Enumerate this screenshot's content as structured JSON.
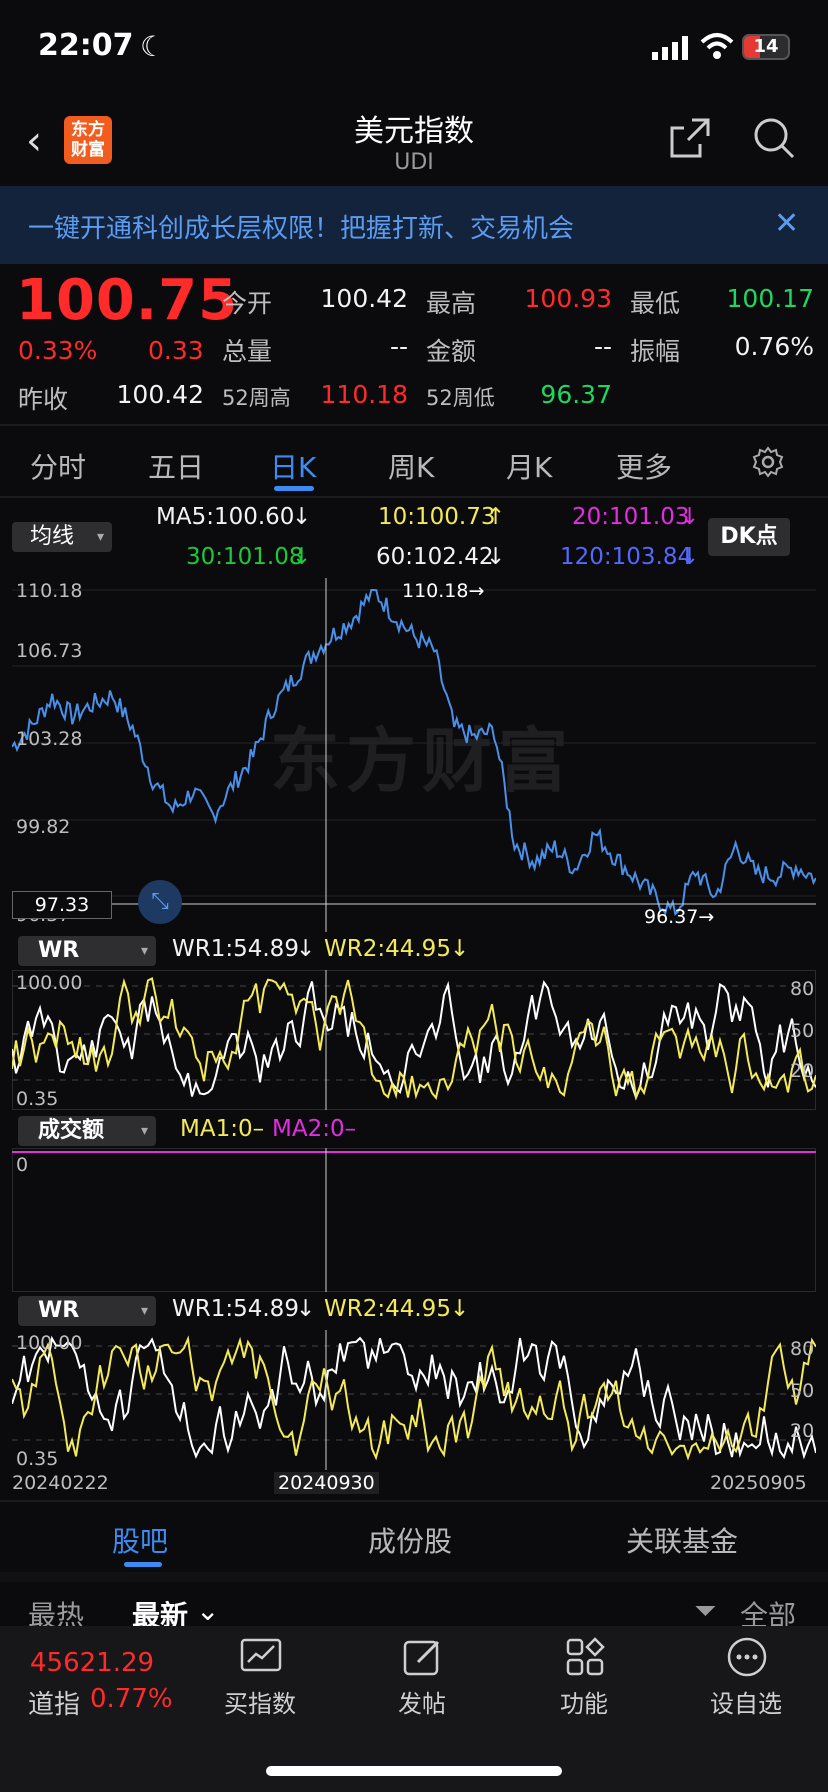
{
  "status_bar": {
    "time": "22:07",
    "battery": "14"
  },
  "header": {
    "logo_text_1": "东方",
    "logo_text_2": "财富",
    "title": "美元指数",
    "subtitle": "UDI"
  },
  "banner": {
    "text": "一键开通科创成长层权限！把握打新、交易机会"
  },
  "quote": {
    "price": "100.75",
    "change_pct": "0.33%",
    "change": "0.33",
    "prev_close_label": "昨收",
    "prev_close": "100.42",
    "open_label": "今开",
    "open": "100.42",
    "high_label": "最高",
    "high": "100.93",
    "low_label": "最低",
    "low": "100.17",
    "volume_label": "总量",
    "volume": "--",
    "amount_label": "金额",
    "amount": "--",
    "amplitude_label": "振幅",
    "amplitude": "0.76%",
    "w52_high_label": "52周高",
    "w52_high": "110.18",
    "w52_low_label": "52周低",
    "w52_low": "96.37"
  },
  "chart_tabs": [
    "分时",
    "五日",
    "日K",
    "周K",
    "月K",
    "更多"
  ],
  "ma": {
    "selector": "均线",
    "ma5": "MA5:100.60",
    "ma10": "10:100.73",
    "ma20": "20:101.03",
    "ma30": "30:101.08",
    "ma60": "60:102.42",
    "ma120": "120:103.84",
    "dk": "DK点"
  },
  "kline": {
    "y_labels": [
      "110.18",
      "106.73",
      "103.28",
      "99.82",
      "96.37"
    ],
    "max_label": "110.18",
    "min_label": "96.37",
    "cursor_price": "97.33",
    "watermark": "东方财富"
  },
  "wr1": {
    "selector": "WR",
    "wr1": "WR1:54.89",
    "wr2": "WR2:44.95",
    "top": "100.00",
    "bottom": "0.35",
    "r80": "80",
    "r50": "50",
    "r20": "20"
  },
  "amount_panel": {
    "selector": "成交额",
    "ma1": "MA1:0–",
    "ma2": "MA2:0–",
    "zero": "0"
  },
  "wr2": {
    "selector": "WR",
    "wr1": "WR1:54.89",
    "wr2": "WR2:44.95",
    "top": "100.00",
    "bottom": "0.35",
    "r80": "80",
    "r50": "50",
    "r20": "20"
  },
  "dates": {
    "start": "20240222",
    "cursor": "20240930",
    "end": "20250905"
  },
  "bottom_tabs": [
    "股吧",
    "成份股",
    "关联基金"
  ],
  "sub_tabs": {
    "hot": "最热",
    "newest": "最新",
    "filter": "全部"
  },
  "footer": {
    "dow_value": "45621.29",
    "dow_label": "道指",
    "dow_pct": "0.77%",
    "buttons": [
      "买指数",
      "发帖",
      "功能",
      "设自选"
    ]
  },
  "colors": {
    "up": "#ff2a2a",
    "down": "#1ed760",
    "accent": "#3d8bf2",
    "line": "#4a8fe8"
  },
  "chart_data": {
    "type": "line",
    "title": "美元指数 日K",
    "x": [
      "20240222",
      "20240930",
      "20250905"
    ],
    "ylim": [
      96.37,
      110.18
    ],
    "series": [
      {
        "name": "",
        "values": [
          103.5,
          104.4,
          105.6,
          104.8,
          105.3,
          105.7,
          104.3,
          102.1,
          100.8,
          101.6,
          100.6,
          101.9,
          103.1,
          105.2,
          106.4,
          107.5,
          108.3,
          109.0,
          110.18,
          109.1,
          108.2,
          107.6,
          104.3,
          103.9,
          104.2,
          99.4,
          98.6,
          99.2,
          98.3,
          99.8,
          98.8,
          97.9,
          97.1,
          96.37,
          98.2,
          97.1,
          99.3,
          98.1,
          98.0,
          98.4,
          97.9
        ]
      }
    ]
  }
}
